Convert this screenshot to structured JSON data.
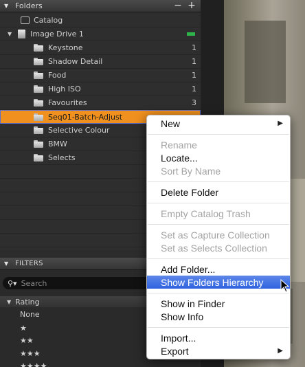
{
  "folders_panel": {
    "title": "Folders",
    "minus": "−",
    "plus": "+",
    "catalog": "Catalog",
    "drive": "Image Drive 1",
    "folders": [
      {
        "label": "Keystone",
        "count": "1"
      },
      {
        "label": "Shadow Detail",
        "count": "1"
      },
      {
        "label": "Food",
        "count": "1"
      },
      {
        "label": "High ISO",
        "count": "1"
      },
      {
        "label": "Favourites",
        "count": "3"
      },
      {
        "label": "Seq01-Batch-Adjust",
        "count": ""
      },
      {
        "label": "Selective Colour",
        "count": ""
      },
      {
        "label": "BMW",
        "count": ""
      },
      {
        "label": "Selects",
        "count": ""
      }
    ]
  },
  "filters_panel": {
    "title": "FILTERS",
    "search_placeholder": "Search",
    "rating_title": "Rating",
    "ratings": [
      "None",
      "★",
      "★★",
      "★★★",
      "★★★★"
    ]
  },
  "context_menu": {
    "new": "New",
    "rename": "Rename",
    "locate": "Locate...",
    "sort_by_name": "Sort By Name",
    "delete_folder": "Delete Folder",
    "empty_trash": "Empty Catalog Trash",
    "set_capture": "Set as Capture Collection",
    "set_selects": "Set as Selects Collection",
    "add_folder": "Add Folder...",
    "show_hierarchy": "Show Folders Hierarchy",
    "show_finder": "Show in Finder",
    "show_info": "Show Info",
    "import": "Import...",
    "export": "Export"
  },
  "colors": {
    "selected_row": "#f0901e",
    "menu_highlight": "#2f63df",
    "drive_status": "#2fb44a"
  }
}
